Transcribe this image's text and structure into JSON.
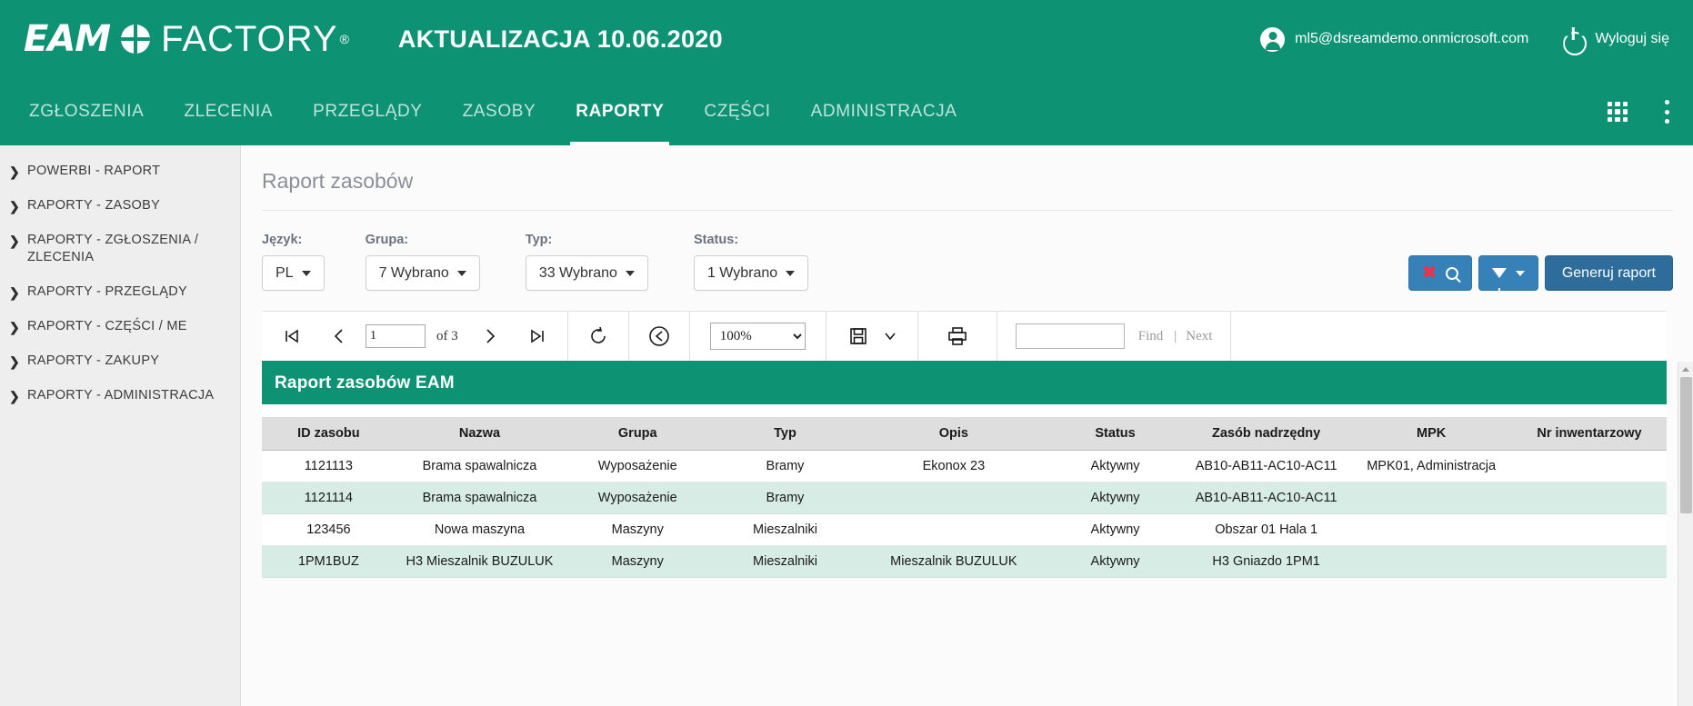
{
  "header": {
    "brand_eam": "EAM",
    "brand_factory": "FACTORY",
    "brand_registered": "®",
    "update_title": "AKTUALIZACJA 10.06.2020",
    "user_email": "ml5@dsreamdemo.onmicrosoft.com",
    "logout_label": "Wyloguj się"
  },
  "nav": {
    "items": [
      {
        "label": "ZGŁOSZENIA",
        "active": false
      },
      {
        "label": "ZLECENIA",
        "active": false
      },
      {
        "label": "PRZEGLĄDY",
        "active": false
      },
      {
        "label": "ZASOBY",
        "active": false
      },
      {
        "label": "RAPORTY",
        "active": true
      },
      {
        "label": "CZĘŚCI",
        "active": false
      },
      {
        "label": "ADMINISTRACJA",
        "active": false
      }
    ]
  },
  "sidebar": {
    "items": [
      {
        "label": "POWERBI - RAPORT"
      },
      {
        "label": "RAPORTY - ZASOBY"
      },
      {
        "label": "RAPORTY - ZGŁOSZENIA / ZLECENIA"
      },
      {
        "label": "RAPORTY - PRZEGLĄDY"
      },
      {
        "label": "RAPORTY - CZĘŚCI / ME"
      },
      {
        "label": "RAPORTY - ZAKUPY"
      },
      {
        "label": "RAPORTY - ADMINISTRACJA"
      }
    ]
  },
  "main": {
    "page_title": "Raport zasobów",
    "filters": [
      {
        "label": "Język:",
        "value": "PL"
      },
      {
        "label": "Grupa:",
        "value": "7 Wybrano"
      },
      {
        "label": "Typ:",
        "value": "33 Wybrano"
      },
      {
        "label": "Status:",
        "value": "1 Wybrano"
      }
    ],
    "actions": {
      "clear_search_label": "",
      "filter_label": "",
      "generate_label": "Generuj raport"
    }
  },
  "viewer": {
    "page_current": "1",
    "page_of": "of 3",
    "zoom_value": "100%",
    "zoom_options": [
      "100%"
    ],
    "find_value": "",
    "find_label": "Find",
    "find_separator": "|",
    "next_label": "Next",
    "report_banner": "Raport zasobów EAM"
  },
  "table": {
    "columns": [
      "ID zasobu",
      "Nazwa",
      "Grupa",
      "Typ",
      "Opis",
      "Status",
      "Zasób nadrzędny",
      "MPK",
      "Nr inwentarzowy"
    ],
    "rows": [
      {
        "id": "1121113",
        "nazwa": "Brama spawalnicza",
        "grupa": "Wyposażenie",
        "typ": "Bramy",
        "opis": "Ekonox 23",
        "status": "Aktywny",
        "parent": "AB10-AB11-AC10-AC11",
        "mpk": "MPK01, Administracja",
        "inv": ""
      },
      {
        "id": "1121114",
        "nazwa": "Brama spawalnicza",
        "grupa": "Wyposażenie",
        "typ": "Bramy",
        "opis": "",
        "status": "Aktywny",
        "parent": "AB10-AB11-AC10-AC11",
        "mpk": "",
        "inv": ""
      },
      {
        "id": "123456",
        "nazwa": "Nowa maszyna",
        "grupa": "Maszyny",
        "typ": "Mieszalniki",
        "opis": "",
        "status": "Aktywny",
        "parent": "Obszar 01 Hala 1",
        "mpk": "",
        "inv": ""
      },
      {
        "id": "1PM1BUZ",
        "nazwa": "H3 Mieszalnik BUZULUK",
        "grupa": "Maszyny",
        "typ": "Mieszalniki",
        "opis": "Mieszalnik BUZULUK",
        "status": "Aktywny",
        "parent": "H3 Gniazdo 1PM1",
        "mpk": "",
        "inv": ""
      }
    ]
  },
  "colors": {
    "brand_green": "#0d9274",
    "button_blue": "#3681b8",
    "button_dark_blue": "#2e6d9b",
    "row_alt": "#d6ece5",
    "accent_red": "#e8334a"
  }
}
